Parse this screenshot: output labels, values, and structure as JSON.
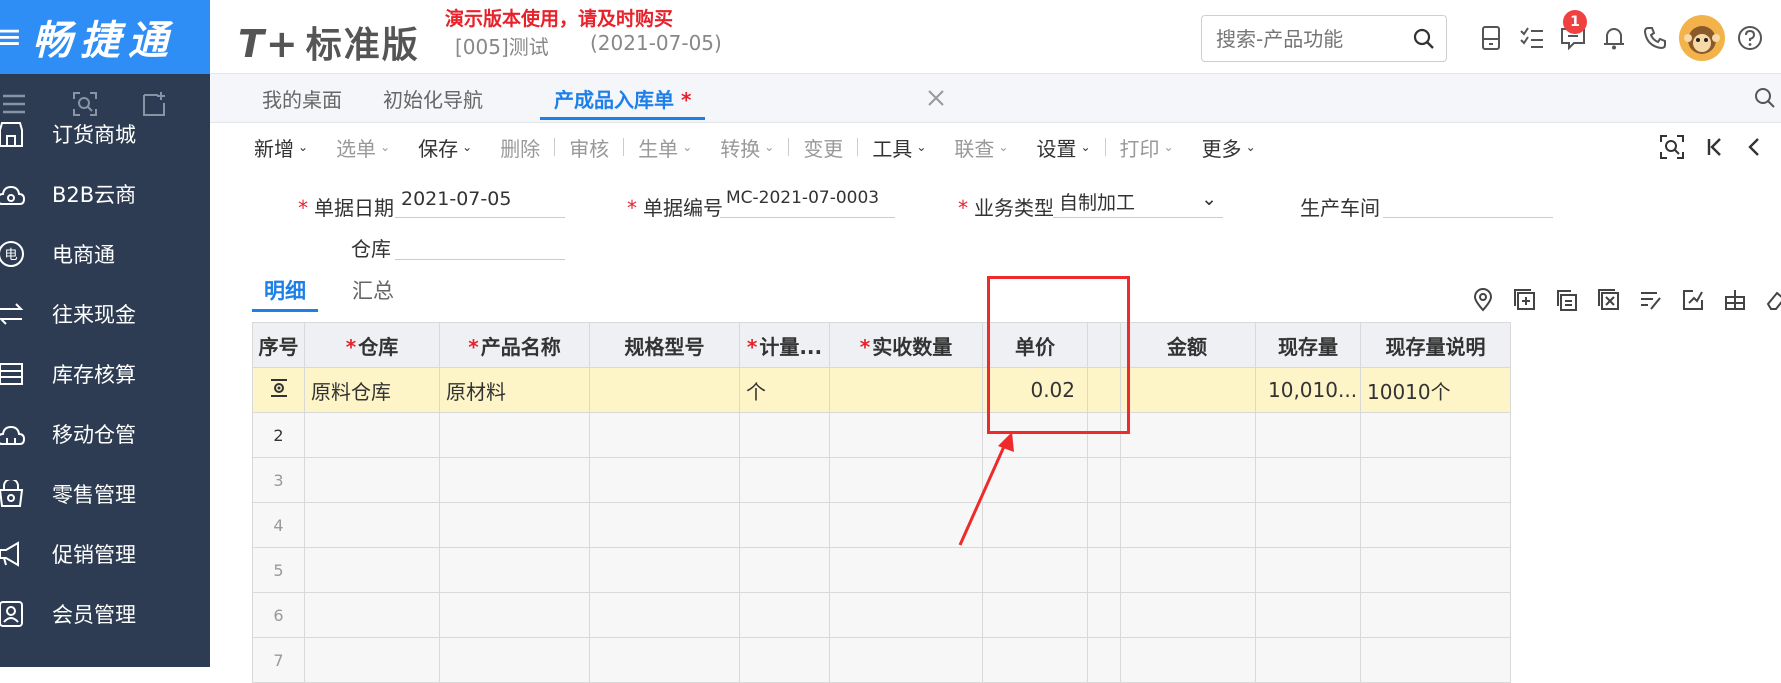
{
  "brand": {
    "name": "畅捷通"
  },
  "header": {
    "product": "标准版",
    "product_prefix": "T+",
    "demo_warning": "演示版本使用，请及时购买",
    "account": "[005]测试",
    "date": "(2021-07-05)",
    "search_placeholder": "搜索-产品功能",
    "notification_count": "1"
  },
  "sidebar": {
    "items": [
      {
        "label": "订货商城",
        "icon": "store-icon"
      },
      {
        "label": "B2B云商",
        "icon": "cloud-shop-icon"
      },
      {
        "label": "电商通",
        "icon": "ecommerce-icon"
      },
      {
        "label": "往来现金",
        "icon": "exchange-icon"
      },
      {
        "label": "库存核算",
        "icon": "inventory-icon"
      },
      {
        "label": "移动仓管",
        "icon": "mobile-warehouse-icon"
      },
      {
        "label": "零售管理",
        "icon": "retail-icon"
      },
      {
        "label": "促销管理",
        "icon": "promotion-icon"
      },
      {
        "label": "会员管理",
        "icon": "member-icon"
      }
    ]
  },
  "tabs": [
    {
      "label": "我的桌面"
    },
    {
      "label": "初始化导航"
    },
    {
      "label": "产成品入库单",
      "star": "*"
    }
  ],
  "toolbar": {
    "items": [
      {
        "label": "新增",
        "dropdown": true,
        "disabled": false
      },
      {
        "label": "选单",
        "dropdown": true,
        "disabled": true
      },
      {
        "label": "保存",
        "dropdown": true,
        "disabled": false
      },
      {
        "label": "删除",
        "dropdown": false,
        "disabled": true
      },
      {
        "label": "审核",
        "dropdown": false,
        "disabled": true
      },
      {
        "label": "生单",
        "dropdown": true,
        "disabled": true
      },
      {
        "label": "转换",
        "dropdown": true,
        "disabled": true
      },
      {
        "label": "变更",
        "dropdown": false,
        "disabled": true
      },
      {
        "label": "工具",
        "dropdown": true,
        "disabled": false
      },
      {
        "label": "联查",
        "dropdown": true,
        "disabled": true
      },
      {
        "label": "设置",
        "dropdown": true,
        "disabled": false
      },
      {
        "label": "打印",
        "dropdown": true,
        "disabled": true
      },
      {
        "label": "更多",
        "dropdown": true,
        "disabled": false
      }
    ]
  },
  "form": {
    "doc_date_label": "单据日期",
    "doc_date": "2021-07-05",
    "doc_no_label": "单据编号",
    "doc_no": "MC-2021-07-0003",
    "biz_type_label": "业务类型",
    "biz_type": "自制加工",
    "workshop_label": "生产车间",
    "workshop": "",
    "warehouse_label": "仓库",
    "warehouse": ""
  },
  "subtabs": {
    "detail": "明细",
    "summary": "汇总"
  },
  "grid": {
    "headers": {
      "seq": "序号",
      "warehouse": "仓库",
      "product": "产品名称",
      "spec": "规格型号",
      "unit": "计量...",
      "qty": "实收数量",
      "price": "单价",
      "amount": "金额",
      "stock": "现存量",
      "stock_desc": "现存量说明"
    },
    "rows": [
      {
        "seq": "",
        "warehouse": "原料仓库",
        "product": "原材料",
        "spec": "",
        "unit": "个",
        "qty": "",
        "price": "0.02",
        "amount": "",
        "stock": "10,010...",
        "stock_desc": "10010个"
      },
      {
        "seq": "2"
      },
      {
        "seq": "3"
      },
      {
        "seq": "4"
      },
      {
        "seq": "5"
      },
      {
        "seq": "6"
      },
      {
        "seq": "7"
      }
    ]
  },
  "colors": {
    "brand": "#2f8ef5",
    "sidebar": "#2d3c52",
    "accent": "#1d7fe8",
    "warning": "#e8222b",
    "selected_row": "#fdf4c8"
  }
}
